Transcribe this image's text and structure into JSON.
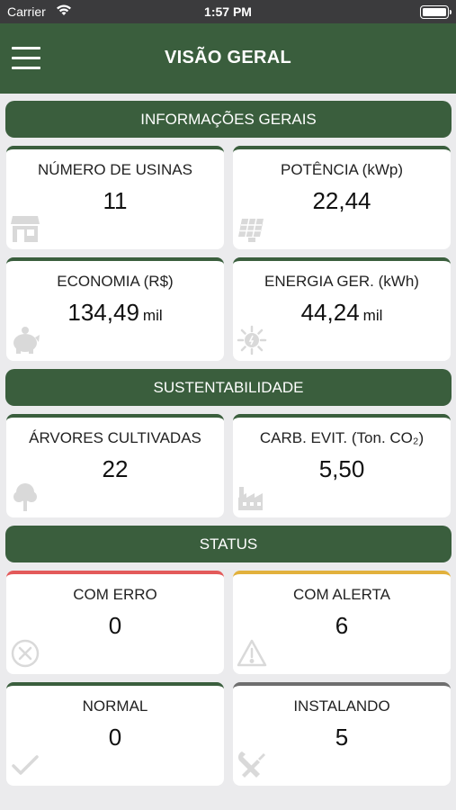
{
  "status_bar": {
    "carrier": "Carrier",
    "time": "1:57 PM"
  },
  "nav": {
    "title": "VISÃO GERAL"
  },
  "sections": {
    "general": {
      "header": "INFORMAÇÕES GERAIS",
      "cards": [
        {
          "label": "NÚMERO DE USINAS",
          "value": "11",
          "unit": "",
          "icon": "store-icon"
        },
        {
          "label": "POTÊNCIA (kWp)",
          "value": "22,44",
          "unit": "",
          "icon": "solar-panel-icon"
        },
        {
          "label": "ECONOMIA (R$)",
          "value": "134,49",
          "unit": "mil",
          "icon": "piggy-bank-icon"
        },
        {
          "label": "ENERGIA GER. (kWh)",
          "value": "44,24",
          "unit": "mil",
          "icon": "sun-energy-icon"
        }
      ]
    },
    "sustainability": {
      "header": "SUSTENTABILIDADE",
      "cards": [
        {
          "label": "ÁRVORES CULTIVADAS",
          "value": "22",
          "unit": "",
          "icon": "tree-icon"
        },
        {
          "label": "CARB. EVIT. (Ton. CO₂)",
          "value": "5,50",
          "unit": "",
          "icon": "factory-icon"
        }
      ]
    },
    "status": {
      "header": "STATUS",
      "cards": [
        {
          "label": "COM ERRO",
          "value": "0",
          "unit": "",
          "icon": "error-circle-icon",
          "color": "#e35a5a"
        },
        {
          "label": "COM ALERTA",
          "value": "6",
          "unit": "",
          "icon": "warning-icon",
          "color": "#e2b13c"
        },
        {
          "label": "NORMAL",
          "value": "0",
          "unit": "",
          "icon": "checkmark-icon",
          "color": "#3a5e3d"
        },
        {
          "label": "INSTALANDO",
          "value": "5",
          "unit": "",
          "icon": "tools-icon",
          "color": "#6e6e6e"
        }
      ]
    }
  },
  "colors": {
    "primary": "#3a5e3d",
    "background": "#ebebed",
    "icon": "#d9d9d9"
  }
}
